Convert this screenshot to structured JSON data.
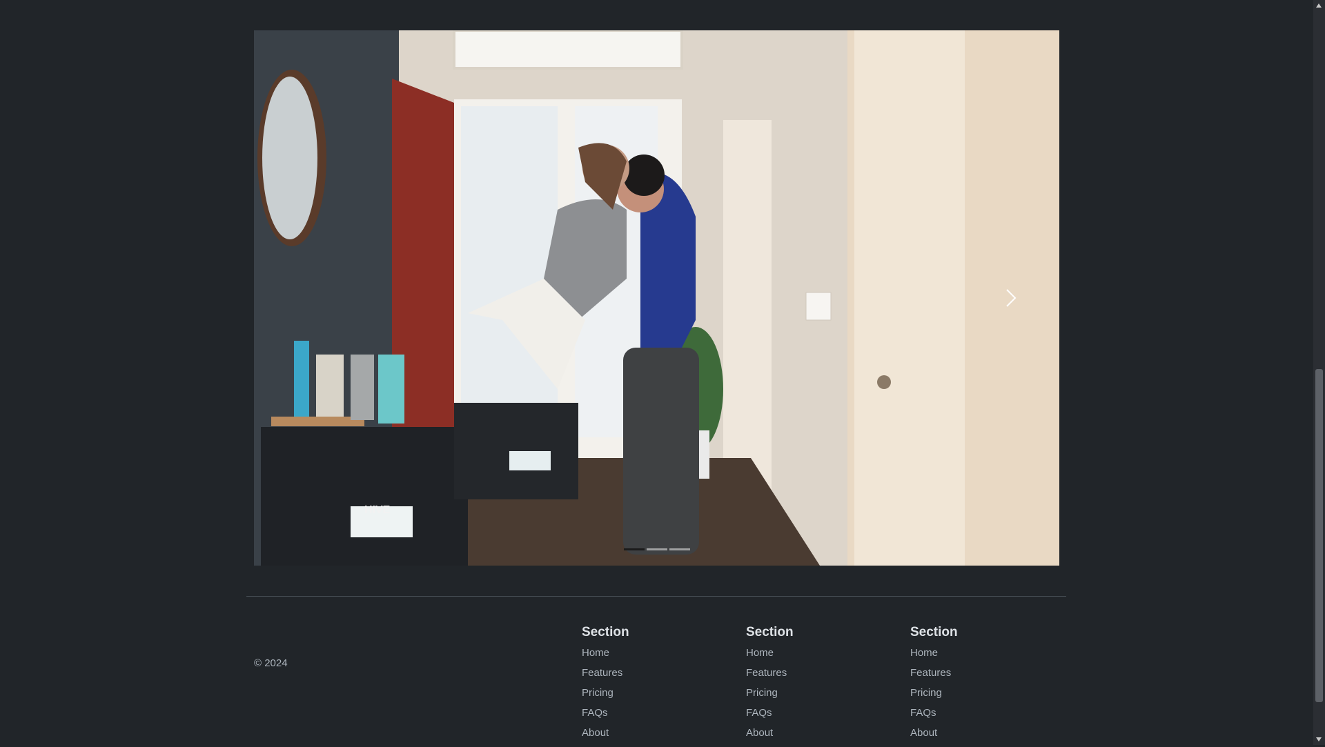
{
  "carousel": {
    "image_alt": "Couple embracing in the entryway of their new home among moving boxes",
    "box_brand": "HIVE BOXX",
    "indicators": [
      {
        "index": 1,
        "active": true
      },
      {
        "index": 2,
        "active": false
      },
      {
        "index": 3,
        "active": false
      }
    ],
    "next_icon": "chevron-right-icon"
  },
  "footer": {
    "copyright": "© 2024",
    "columns": [
      {
        "heading": "Section",
        "links": [
          "Home",
          "Features",
          "Pricing",
          "FAQs",
          "About"
        ]
      },
      {
        "heading": "Section",
        "links": [
          "Home",
          "Features",
          "Pricing",
          "FAQs",
          "About"
        ]
      },
      {
        "heading": "Section",
        "links": [
          "Home",
          "Features",
          "Pricing",
          "FAQs",
          "About"
        ]
      }
    ]
  },
  "colors": {
    "background": "#212529",
    "heading": "#dee2e6",
    "text": "#adb5bd",
    "divider": "#495057"
  }
}
